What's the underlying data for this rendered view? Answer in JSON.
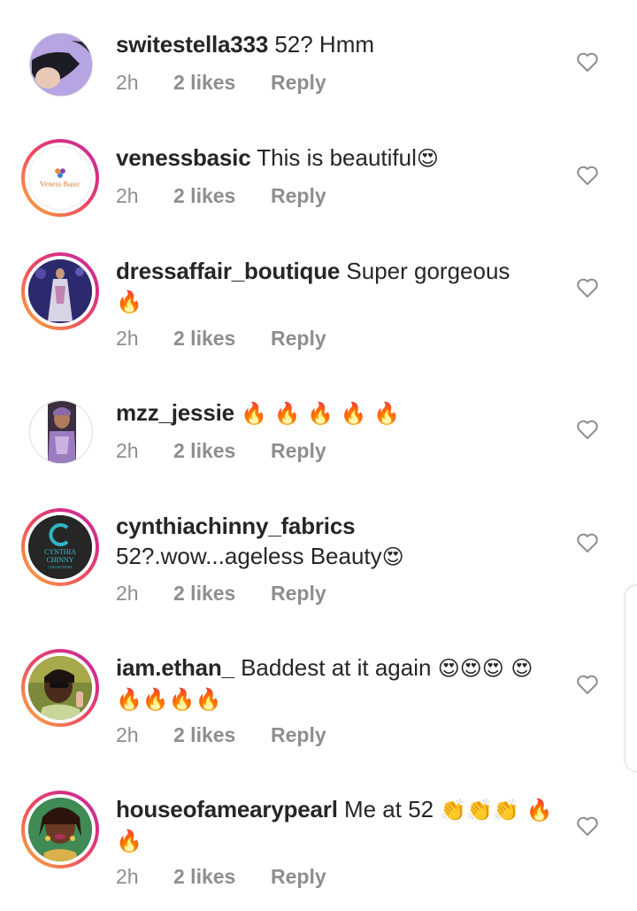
{
  "comments": [
    {
      "username": "switestella333",
      "text": "52? Hmm",
      "emoji": "",
      "time": "2h",
      "likes": "2 likes",
      "reply": "Reply",
      "avatar_style": "plain-lavender"
    },
    {
      "username": "venessbasic",
      "text": "This is beautiful",
      "emoji": "😍",
      "time": "2h",
      "likes": "2 likes",
      "reply": "Reply",
      "avatar_text": "Veness Basic"
    },
    {
      "username": "dressaffair_boutique",
      "text": "Super gorgeous",
      "emoji": "🔥",
      "time": "2h",
      "likes": "2 likes",
      "reply": "Reply"
    },
    {
      "username": "mzz_jessie",
      "text": "",
      "emoji": "🔥 🔥 🔥 🔥 🔥",
      "time": "2h",
      "likes": "2 likes",
      "reply": "Reply"
    },
    {
      "username": "cynthiachinny_fabrics",
      "text": "52?.wow...ageless Beauty",
      "emoji": "😍",
      "time": "2h",
      "likes": "2 likes",
      "reply": "Reply",
      "avatar_text_1": "CYNTHIA",
      "avatar_text_2": "CHINNY",
      "avatar_text_3": "COLLECTIONS"
    },
    {
      "username": "iam.ethan_",
      "text": "Baddest at it again",
      "emoji": "😍😍😍 😍🔥🔥🔥🔥",
      "time": "2h",
      "likes": "2 likes",
      "reply": "Reply"
    },
    {
      "username": "houseofamearypearl",
      "text": "Me at 52",
      "emoji": "👏👏👏 🔥🔥",
      "time": "2h",
      "likes": "2 likes",
      "reply": "Reply"
    }
  ],
  "icons": {
    "like": "heart-outline-icon"
  },
  "colors": {
    "text": "#262626",
    "meta": "#8e8e8e",
    "ring_start": "#f9b43a",
    "ring_end": "#c22fa8"
  }
}
